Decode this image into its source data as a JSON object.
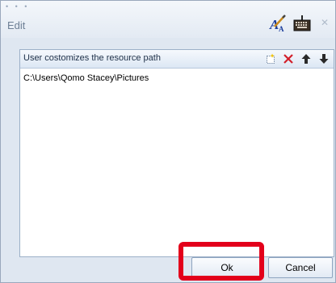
{
  "window": {
    "title": "Edit",
    "close_glyph": "✕",
    "toolbar_icons": [
      "spell-check-icon",
      "keyboard-icon"
    ]
  },
  "panel": {
    "header_label": "User costomizes the resource path",
    "tools": [
      "new-icon",
      "delete-icon",
      "move-up-icon",
      "move-down-icon"
    ],
    "paths": [
      "C:\\Users\\Qomo Stacey\\Pictures"
    ]
  },
  "buttons": {
    "ok_label": "Ok",
    "cancel_label": "Cancel"
  },
  "colors": {
    "highlight": "#e3001b",
    "delete": "#d21f2a"
  }
}
